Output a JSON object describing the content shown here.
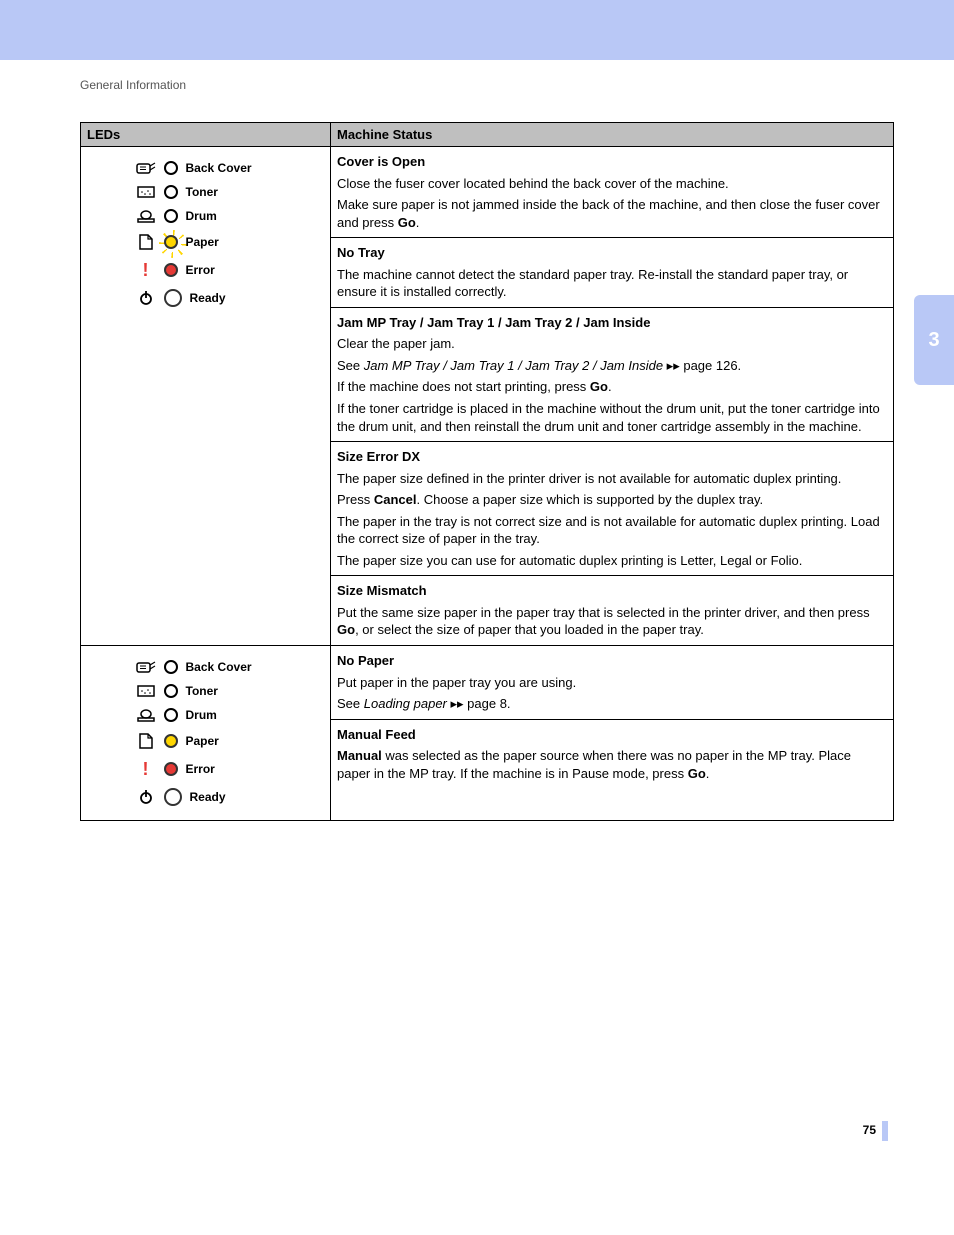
{
  "header": "General Information",
  "chapter": "3",
  "page_number": "75",
  "table": {
    "col1": "LEDs",
    "col2": "Machine Status"
  },
  "leds": {
    "back_cover": "Back Cover",
    "toner": "Toner",
    "drum": "Drum",
    "paper": "Paper",
    "error": "Error",
    "ready": "Ready"
  },
  "statuses": {
    "s1": {
      "title": "Cover is Open",
      "p1": "Close the fuser cover located behind the back cover of the machine.",
      "p2a": "Make sure paper is not jammed inside the back of the machine, and then close the fuser cover and press ",
      "p2b": "Go",
      "p2c": "."
    },
    "s2": {
      "title": "No Tray",
      "p1": "The machine cannot detect the standard paper tray. Re-install the standard paper tray, or ensure it is installed correctly."
    },
    "s3": {
      "titleA": "Jam MP Tray",
      "sep": " / ",
      "titleB": "Jam Tray 1",
      "titleC": "Jam Tray 2",
      "titleD": "Jam Inside",
      "p1": "Clear the paper jam.",
      "p2a": "See ",
      "p2b": "Jam MP Tray / Jam Tray 1 / Jam Tray 2 / Jam Inside",
      "p2c": " ▸▸ page 126.",
      "p3a": "If the machine does not start printing, press ",
      "p3b": "Go",
      "p3c": ".",
      "p4": "If the toner cartridge is placed in the machine without the drum unit, put the toner cartridge into the drum unit, and then reinstall the drum unit and toner cartridge assembly in the machine."
    },
    "s4": {
      "title": "Size Error DX",
      "p1": "The paper size defined in the printer driver is not available for automatic duplex printing.",
      "p2a": "Press ",
      "p2b": "Cancel",
      "p2c": ". Choose a paper size which is supported by the duplex tray.",
      "p3": "The paper in the tray is not correct size and is not available for automatic duplex printing. Load the correct size of paper in the tray.",
      "p4": "The paper size you can use for automatic duplex printing is Letter, Legal or Folio."
    },
    "s5": {
      "title": "Size Mismatch",
      "p1a": "Put the same size paper in the paper tray that is selected in the printer driver, and then press ",
      "p1b": "Go",
      "p1c": ", or select the size of paper that you loaded in the paper tray."
    },
    "s6": {
      "title": "No Paper",
      "p1": "Put paper in the paper tray you are using.",
      "p2a": "See ",
      "p2b": "Loading paper",
      "p2c": " ▸▸ page 8."
    },
    "s7": {
      "title": "Manual Feed",
      "p1a": "Manual",
      "p1b": " was selected as the paper source when there was no paper in the MP tray. Place paper in the MP tray. If the machine is in Pause mode, press ",
      "p1c": "Go",
      "p1d": "."
    }
  }
}
